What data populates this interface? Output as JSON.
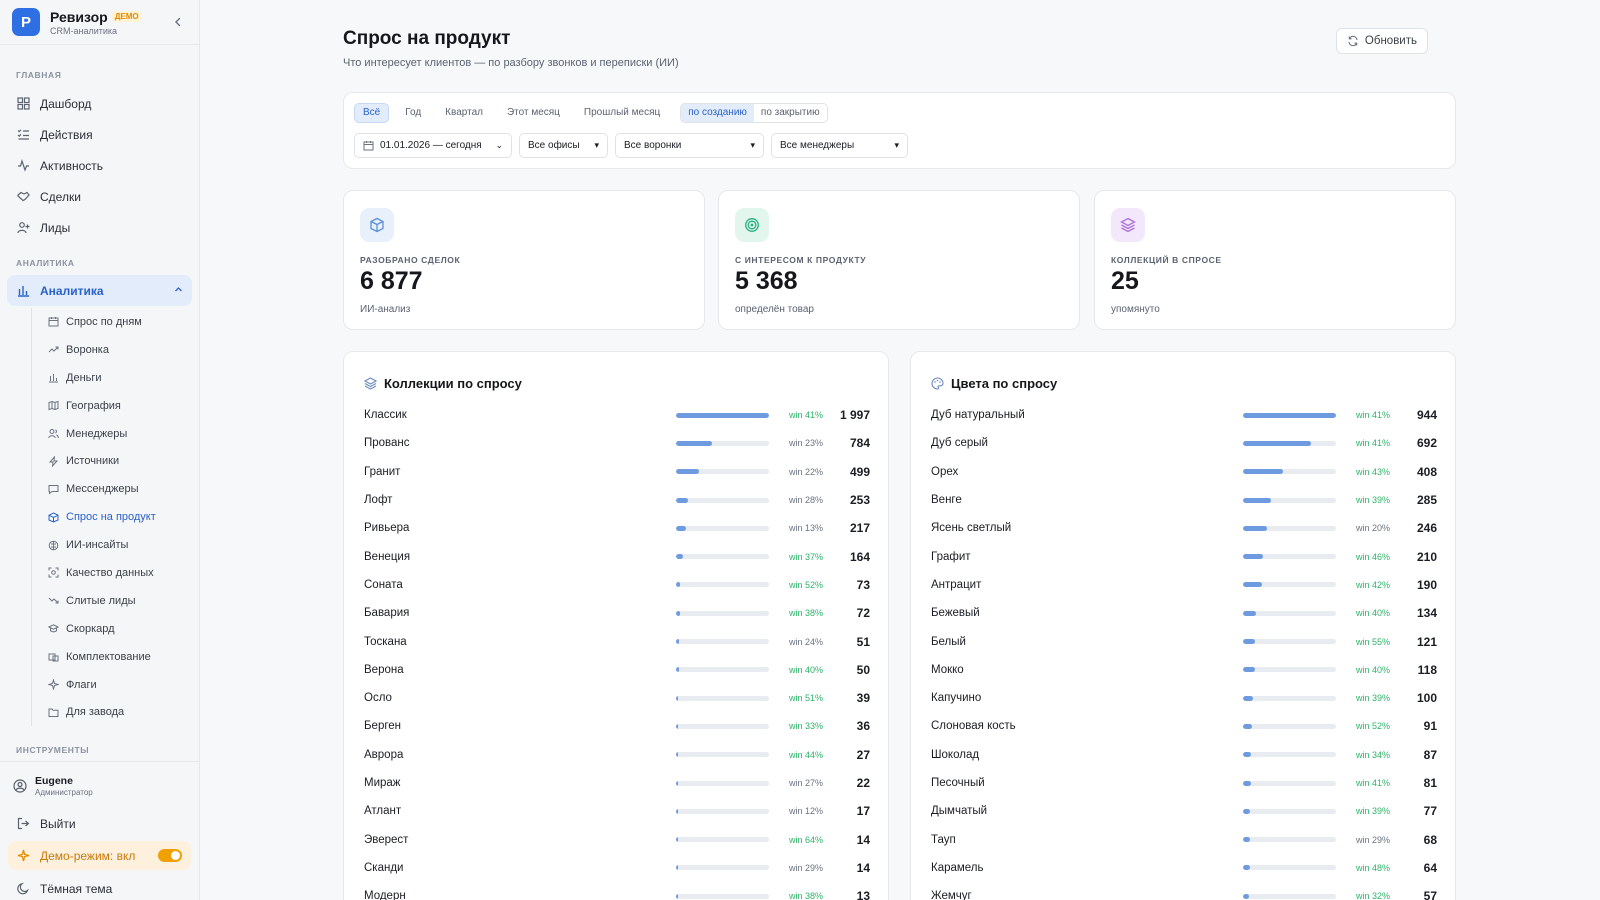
{
  "brand": {
    "logo": "P",
    "name": "Ревизор",
    "badge": "ДЕМО",
    "subtitle": "CRM-аналитика"
  },
  "sidebar": {
    "section_main": "ГЛАВНАЯ",
    "main_items": [
      {
        "label": "Дашборд",
        "icon": "grid-icon"
      },
      {
        "label": "Действия",
        "icon": "list-check-icon"
      },
      {
        "label": "Активность",
        "icon": "activity-icon"
      },
      {
        "label": "Сделки",
        "icon": "handshake-icon"
      },
      {
        "label": "Лиды",
        "icon": "user-plus-icon"
      }
    ],
    "section_analytics": "АНАЛИТИКА",
    "analytics_label": "Аналитика",
    "sub_items": [
      {
        "label": "Спрос по дням"
      },
      {
        "label": "Воронка"
      },
      {
        "label": "Деньги"
      },
      {
        "label": "География"
      },
      {
        "label": "Менеджеры"
      },
      {
        "label": "Источники"
      },
      {
        "label": "Мессенджеры"
      },
      {
        "label": "Спрос на продукт"
      },
      {
        "label": "ИИ-инсайты"
      },
      {
        "label": "Качество данных"
      },
      {
        "label": "Слитые лиды"
      },
      {
        "label": "Скоркард"
      },
      {
        "label": "Комплектование"
      },
      {
        "label": "Флаги"
      },
      {
        "label": "Для завода"
      }
    ],
    "section_tools": "ИНСТРУМЕНТЫ",
    "user": {
      "name": "Eugene",
      "role": "Администратор"
    },
    "logout": "Выйти",
    "demo_mode": "Демо-режим: вкл",
    "dark_theme": "Тёмная тема"
  },
  "header": {
    "title": "Спрос на продукт",
    "subtitle": "Что интересует клиентов — по разбору звонков и переписки (ИИ)",
    "refresh": "Обновить"
  },
  "filters": {
    "periods": [
      "Всё",
      "Год",
      "Квартал",
      "Этот месяц",
      "Прошлый месяц"
    ],
    "modes": [
      "по созданию",
      "по закрытию"
    ],
    "date_range": "01.01.2026 — сегодня",
    "offices": "Все офисы",
    "funnels": "Все воронки",
    "managers": "Все менеджеры"
  },
  "kpis": [
    {
      "label": "РАЗОБРАНО СДЕЛОК",
      "value": "6 877",
      "note": "ИИ-анализ",
      "color": "#5b8fd9",
      "bg": "#e8f0fb"
    },
    {
      "label": "С ИНТЕРЕСОМ К ПРОДУКТУ",
      "value": "5 368",
      "note": "определён товар",
      "color": "#22b07d",
      "bg": "#e2f6ee"
    },
    {
      "label": "КОЛЛЕКЦИЙ В СПРОСЕ",
      "value": "25",
      "note": "упомянуто",
      "color": "#b06ed9",
      "bg": "#f3e8fb"
    }
  ],
  "collections": {
    "title": "Коллекции по спросу",
    "rows": [
      {
        "name": "Классик",
        "win": "win 41%",
        "count": "1 997",
        "value": 1997
      },
      {
        "name": "Прованс",
        "win": "win 23%",
        "count": "784",
        "value": 784
      },
      {
        "name": "Гранит",
        "win": "win 22%",
        "count": "499",
        "value": 499
      },
      {
        "name": "Лофт",
        "win": "win 28%",
        "count": "253",
        "value": 253
      },
      {
        "name": "Ривьера",
        "win": "win 13%",
        "count": "217",
        "value": 217
      },
      {
        "name": "Венеция",
        "win": "win 37%",
        "count": "164",
        "value": 164
      },
      {
        "name": "Соната",
        "win": "win 52%",
        "count": "73",
        "value": 73
      },
      {
        "name": "Бавария",
        "win": "win 38%",
        "count": "72",
        "value": 72
      },
      {
        "name": "Тоскана",
        "win": "win 24%",
        "count": "51",
        "value": 51
      },
      {
        "name": "Верона",
        "win": "win 40%",
        "count": "50",
        "value": 50
      },
      {
        "name": "Осло",
        "win": "win 51%",
        "count": "39",
        "value": 39
      },
      {
        "name": "Берген",
        "win": "win 33%",
        "count": "36",
        "value": 36
      },
      {
        "name": "Аврора",
        "win": "win 44%",
        "count": "27",
        "value": 27
      },
      {
        "name": "Мираж",
        "win": "win 27%",
        "count": "22",
        "value": 22
      },
      {
        "name": "Атлант",
        "win": "win 12%",
        "count": "17",
        "value": 17
      },
      {
        "name": "Эверест",
        "win": "win 64%",
        "count": "14",
        "value": 14
      },
      {
        "name": "Сканди",
        "win": "win 29%",
        "count": "14",
        "value": 14
      },
      {
        "name": "Модерн",
        "win": "win 38%",
        "count": "13",
        "value": 13
      }
    ]
  },
  "colors": {
    "title": "Цвета по спросу",
    "rows": [
      {
        "name": "Дуб натуральный",
        "win": "win 41%",
        "count": "944",
        "value": 944
      },
      {
        "name": "Дуб серый",
        "win": "win 41%",
        "count": "692",
        "value": 692
      },
      {
        "name": "Орех",
        "win": "win 43%",
        "count": "408",
        "value": 408
      },
      {
        "name": "Венге",
        "win": "win 39%",
        "count": "285",
        "value": 285
      },
      {
        "name": "Ясень светлый",
        "win": "win 20%",
        "count": "246",
        "value": 246
      },
      {
        "name": "Графит",
        "win": "win 46%",
        "count": "210",
        "value": 210
      },
      {
        "name": "Антрацит",
        "win": "win 42%",
        "count": "190",
        "value": 190
      },
      {
        "name": "Бежевый",
        "win": "win 40%",
        "count": "134",
        "value": 134
      },
      {
        "name": "Белый",
        "win": "win 55%",
        "count": "121",
        "value": 121
      },
      {
        "name": "Мокко",
        "win": "win 40%",
        "count": "118",
        "value": 118
      },
      {
        "name": "Капучино",
        "win": "win 39%",
        "count": "100",
        "value": 100
      },
      {
        "name": "Слоновая кость",
        "win": "win 52%",
        "count": "91",
        "value": 91
      },
      {
        "name": "Шоколад",
        "win": "win 34%",
        "count": "87",
        "value": 87
      },
      {
        "name": "Песочный",
        "win": "win 41%",
        "count": "81",
        "value": 81
      },
      {
        "name": "Дымчатый",
        "win": "win 39%",
        "count": "77",
        "value": 77
      },
      {
        "name": "Тауп",
        "win": "win 29%",
        "count": "68",
        "value": 68
      },
      {
        "name": "Карамель",
        "win": "win 48%",
        "count": "64",
        "value": 64
      },
      {
        "name": "Жемчуг",
        "win": "win 32%",
        "count": "57",
        "value": 57
      }
    ]
  }
}
